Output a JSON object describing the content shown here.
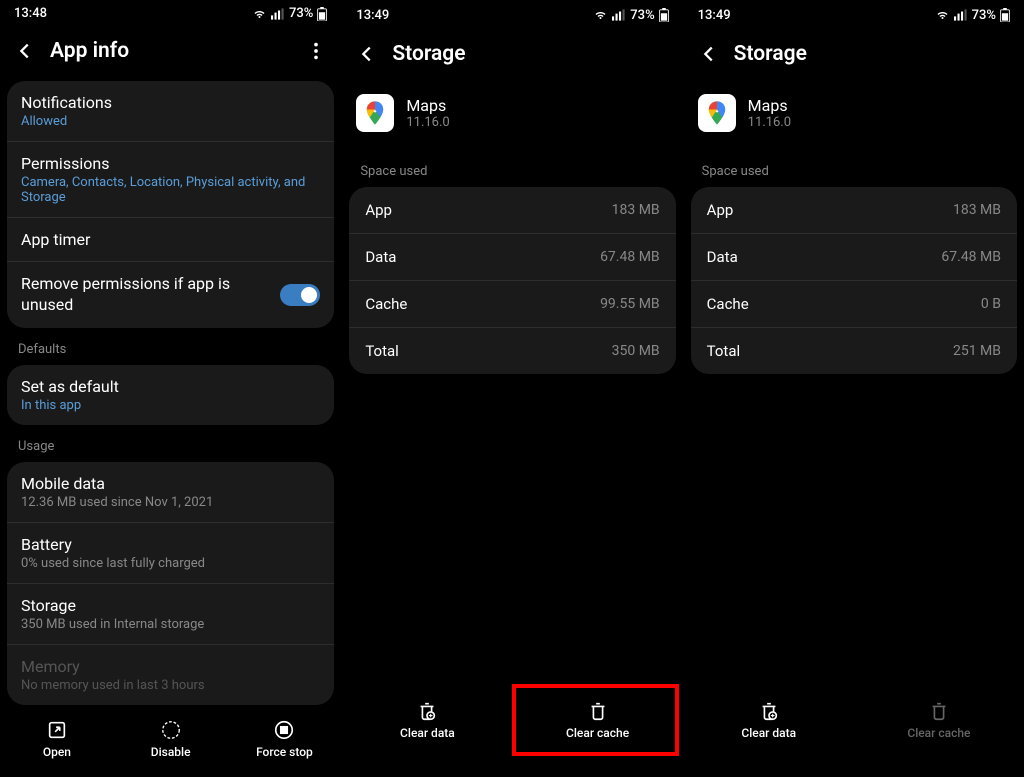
{
  "screen1": {
    "status": {
      "time": "13:48",
      "battery": "73%"
    },
    "title": "App info",
    "rows": {
      "notifications": {
        "label": "Notifications",
        "sub": "Allowed"
      },
      "permissions": {
        "label": "Permissions",
        "sub": "Camera, Contacts, Location, Physical activity, and Storage"
      },
      "apptimer": {
        "label": "App timer"
      },
      "remove": {
        "label": "Remove permissions if app is unused"
      }
    },
    "defaults_header": "Defaults",
    "setdefault": {
      "label": "Set as default",
      "sub": "In this app"
    },
    "usage_header": "Usage",
    "usage": {
      "mobile": {
        "label": "Mobile data",
        "sub": "12.36 MB used since Nov 1, 2021"
      },
      "battery": {
        "label": "Battery",
        "sub": "0% used since last fully charged"
      },
      "storage": {
        "label": "Storage",
        "sub": "350 MB used in Internal storage"
      },
      "memory": {
        "label": "Memory",
        "sub": "No memory used in last 3 hours"
      }
    },
    "bottom": {
      "open": "Open",
      "disable": "Disable",
      "forcestop": "Force stop"
    }
  },
  "screen2": {
    "status": {
      "time": "13:49",
      "battery": "73%"
    },
    "title": "Storage",
    "app": {
      "name": "Maps",
      "version": "11.16.0"
    },
    "space_header": "Space used",
    "rows": {
      "app": {
        "label": "App",
        "value": "183 MB"
      },
      "data": {
        "label": "Data",
        "value": "67.48 MB"
      },
      "cache": {
        "label": "Cache",
        "value": "99.55 MB"
      },
      "total": {
        "label": "Total",
        "value": "350 MB"
      }
    },
    "bottom": {
      "cleardata": "Clear data",
      "clearcache": "Clear cache"
    }
  },
  "screen3": {
    "status": {
      "time": "13:49",
      "battery": "73%"
    },
    "title": "Storage",
    "app": {
      "name": "Maps",
      "version": "11.16.0"
    },
    "space_header": "Space used",
    "rows": {
      "app": {
        "label": "App",
        "value": "183 MB"
      },
      "data": {
        "label": "Data",
        "value": "67.48 MB"
      },
      "cache": {
        "label": "Cache",
        "value": "0 B"
      },
      "total": {
        "label": "Total",
        "value": "251 MB"
      }
    },
    "bottom": {
      "cleardata": "Clear data",
      "clearcache": "Clear cache"
    }
  }
}
